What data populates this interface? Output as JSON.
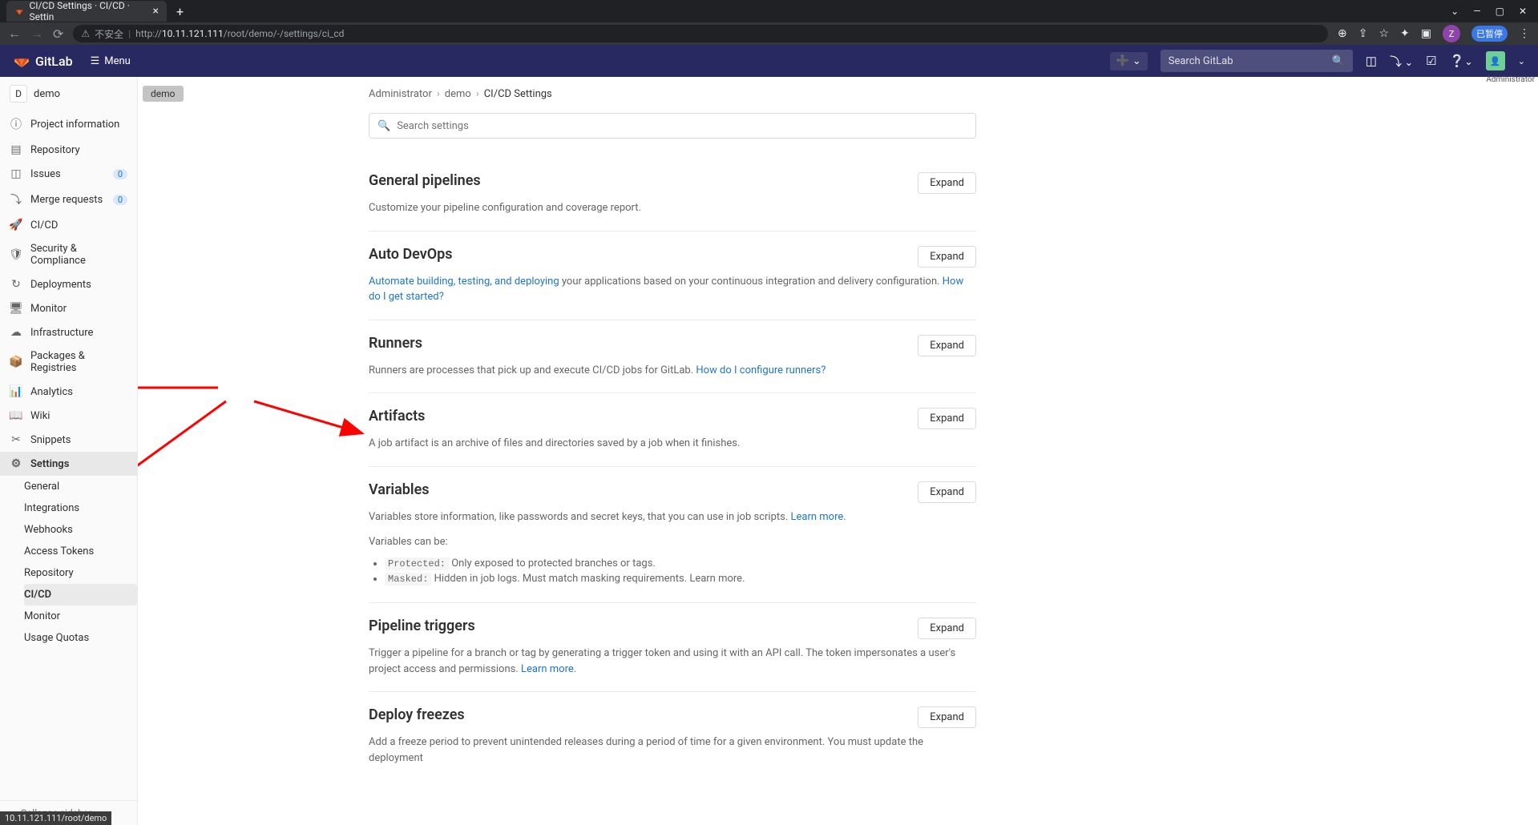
{
  "browser": {
    "tab_title": "CI/CD Settings · CI/CD · Settin",
    "url_insecure": "不安全",
    "url_prefix": "http://",
    "url_host": "10.11.121.111",
    "url_path": "/root/demo/-/settings/ci_cd",
    "avatar_letter": "Z",
    "pause_label": "已暂停",
    "status_url": "10.11.121.111/root/demo"
  },
  "header": {
    "brand": "GitLab",
    "menu": "Menu",
    "search_placeholder": "Search GitLab",
    "admin_label": "Administrator"
  },
  "sidebar": {
    "project_letter": "D",
    "project_name": "demo",
    "items": [
      {
        "icon": "info",
        "label": "Project information"
      },
      {
        "icon": "repo",
        "label": "Repository"
      },
      {
        "icon": "issues",
        "label": "Issues",
        "badge": "0"
      },
      {
        "icon": "merge",
        "label": "Merge requests",
        "badge": "0"
      },
      {
        "icon": "rocket",
        "label": "CI/CD"
      },
      {
        "icon": "shield",
        "label": "Security & Compliance"
      },
      {
        "icon": "deploy",
        "label": "Deployments"
      },
      {
        "icon": "monitor",
        "label": "Monitor"
      },
      {
        "icon": "infra",
        "label": "Infrastructure"
      },
      {
        "icon": "package",
        "label": "Packages & Registries"
      },
      {
        "icon": "chart",
        "label": "Analytics"
      },
      {
        "icon": "book",
        "label": "Wiki"
      },
      {
        "icon": "scissors",
        "label": "Snippets"
      },
      {
        "icon": "gear",
        "label": "Settings"
      }
    ],
    "settings_sub": [
      {
        "label": "General"
      },
      {
        "label": "Integrations"
      },
      {
        "label": "Webhooks"
      },
      {
        "label": "Access Tokens"
      },
      {
        "label": "Repository"
      },
      {
        "label": "CI/CD",
        "active": true
      },
      {
        "label": "Monitor"
      },
      {
        "label": "Usage Quotas"
      }
    ],
    "collapse": "Collapse sidebar"
  },
  "context_pill": "demo",
  "breadcrumb": {
    "admin": "Administrator",
    "project": "demo",
    "current": "CI/CD Settings"
  },
  "search_settings_placeholder": "Search settings",
  "expand_label": "Expand",
  "sections": {
    "general": {
      "title": "General pipelines",
      "desc": "Customize your pipeline configuration and coverage report."
    },
    "autodevops": {
      "title": "Auto DevOps",
      "link1": "Automate building, testing, and deploying",
      "desc": " your applications based on your continuous integration and delivery configuration. ",
      "link2": "How do I get started?"
    },
    "runners": {
      "title": "Runners",
      "desc": "Runners are processes that pick up and execute CI/CD jobs for GitLab. ",
      "link": "How do I configure runners?"
    },
    "artifacts": {
      "title": "Artifacts",
      "desc": "A job artifact is an archive of files and directories saved by a job when it finishes."
    },
    "variables": {
      "title": "Variables",
      "desc": "Variables store information, like passwords and secret keys, that you can use in job scripts. ",
      "learn": "Learn more.",
      "canbe": "Variables can be:",
      "protected_code": "Protected:",
      "protected_desc": " Only exposed to protected branches or tags.",
      "masked_code": "Masked:",
      "masked_desc": " Hidden in job logs. Must match masking requirements. ",
      "masked_link": "Learn more."
    },
    "triggers": {
      "title": "Pipeline triggers",
      "desc": "Trigger a pipeline for a branch or tag by generating a trigger token and using it with an API call. The token impersonates a user's project access and permissions. ",
      "link": "Learn more."
    },
    "freezes": {
      "title": "Deploy freezes",
      "desc": "Add a freeze period to prevent unintended releases during a period of time for a given environment. You must update the deployment"
    }
  }
}
